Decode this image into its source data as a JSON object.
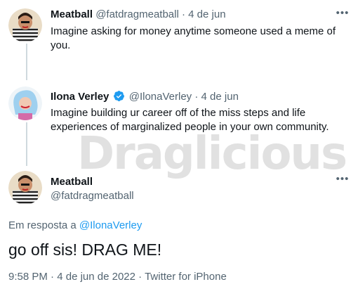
{
  "tweets": [
    {
      "name": "Meatball",
      "handle": "@fatdragmeatball",
      "sep": "·",
      "date": "4 de jun",
      "text": "Imagine asking for money anytime someone used a meme of you."
    },
    {
      "name": "Ilona Verley",
      "handle": "@IlonaVerley",
      "sep": "·",
      "date": "4 de jun",
      "text": "Imagine building ur career off of the miss steps and life experiences of marginalized people in your own community."
    }
  ],
  "main_tweet": {
    "name": "Meatball",
    "handle": "@fatdragmeatball",
    "reply_prefix": "Em resposta a",
    "reply_handle": "@IlonaVerley",
    "text": "go off sis! DRAG ME!",
    "time": "9:58 PM",
    "sep1": "·",
    "date": "4 de jun de 2022",
    "sep2": "·",
    "source": "Twitter for iPhone"
  },
  "watermark": "Draglicious",
  "colors": {
    "text": "#0f1419",
    "muted": "#536471",
    "link": "#1d9bf0",
    "verified": "#1d9bf0"
  },
  "icons": [
    "more-options-icon",
    "verified-badge-icon"
  ]
}
